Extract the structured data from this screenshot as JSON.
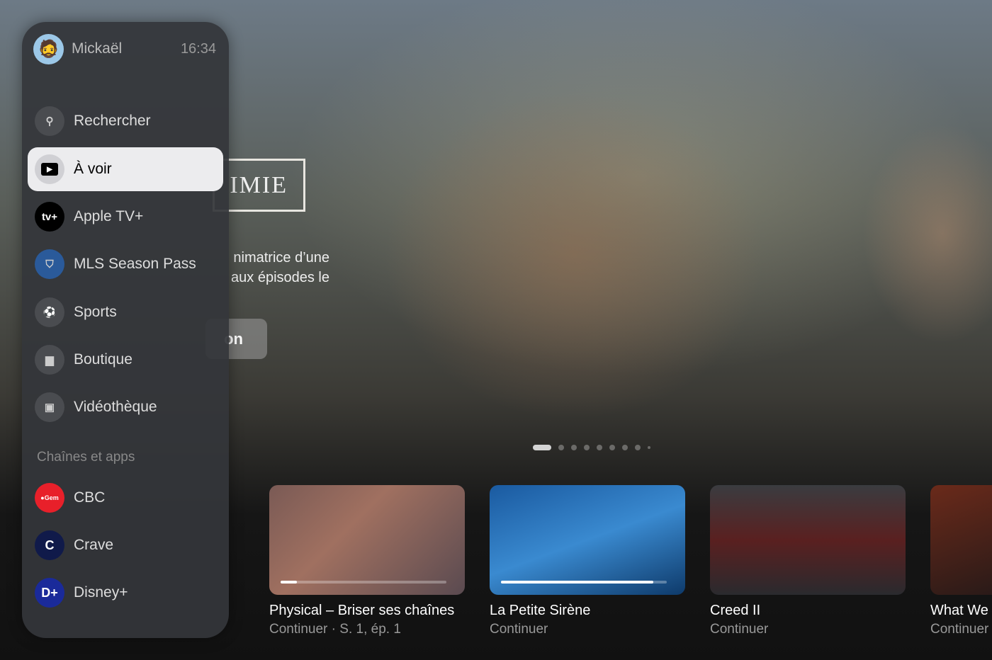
{
  "hero": {
    "title_fragment": "IMIE",
    "description_fragment_1": "nimatrice d’une",
    "description_fragment_2": "aux épisodes le",
    "button_fragment": "on",
    "page_dots": 9,
    "active_dot": 1
  },
  "user": {
    "name": "Mickaël",
    "time": "16:34",
    "avatar": "memoji-avatar"
  },
  "nav": [
    {
      "label": "Rechercher",
      "icon": "search-icon",
      "glyph": "⚲"
    },
    {
      "label": "À voir",
      "icon": "play-icon",
      "glyph": "▶",
      "selected": true
    },
    {
      "label": "Apple TV+",
      "icon": "apple-tv-plus-icon",
      "glyph": "tv+"
    },
    {
      "label": "MLS Season Pass",
      "icon": "mls-icon",
      "glyph": "⛉"
    },
    {
      "label": "Sports",
      "icon": "sports-icon",
      "glyph": "⚽"
    },
    {
      "label": "Boutique",
      "icon": "bag-icon",
      "glyph": "▆"
    },
    {
      "label": "Vidéothèque",
      "icon": "library-icon",
      "glyph": "▣"
    }
  ],
  "channels_title": "Chaînes et apps",
  "channels": [
    {
      "label": "CBC",
      "icon": "cbc-gem-icon",
      "glyph": "●Gem",
      "color": "#e8202a"
    },
    {
      "label": "Crave",
      "icon": "crave-icon",
      "glyph": "C",
      "color": "#101a4a"
    },
    {
      "label": "Disney+",
      "icon": "disney-plus-icon",
      "glyph": "D+",
      "color": "#1a2a9a"
    }
  ],
  "up_next": [
    {
      "title": "Physical – Briser ses chaînes",
      "subtitle": "Continuer · S. 1, ép. 1",
      "progress": 0.1,
      "bg": "linear-gradient(135deg,#7a5a55,#a07060 40%,#5a4a50)"
    },
    {
      "title": "La Petite Sirène",
      "subtitle": "Continuer",
      "progress": 0.92,
      "bg": "linear-gradient(160deg,#1a5aa0,#3a8ad0 50%,#0e3a6a)"
    },
    {
      "title": "Creed II",
      "subtitle": "Continuer",
      "progress": null,
      "bg": "linear-gradient(180deg,#3a3c40,#5a2020 50%,#2a2a2e)"
    },
    {
      "title": "What We",
      "subtitle": "Continuer",
      "progress": null,
      "bg": "linear-gradient(160deg,#6a2a1a,#2a1a18)"
    }
  ]
}
